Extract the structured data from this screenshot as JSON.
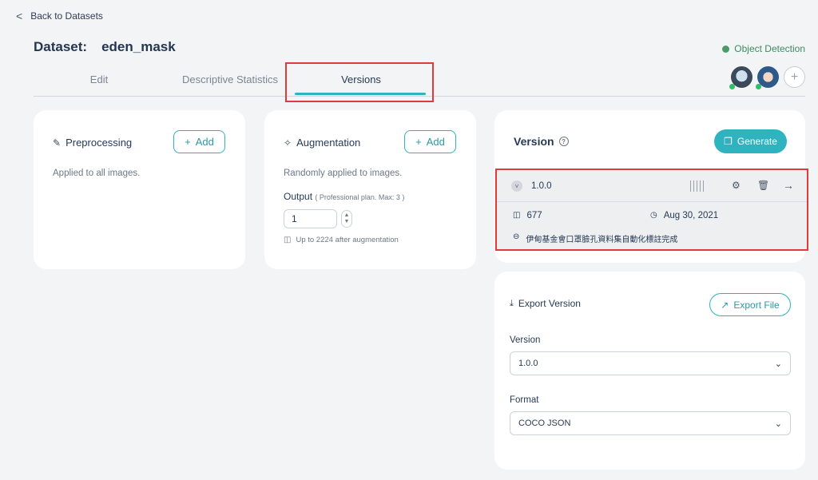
{
  "nav": {
    "back_label": "Back to Datasets"
  },
  "header": {
    "dataset_label": "Dataset:",
    "dataset_name": "eden_mask",
    "project_type": "Object Detection",
    "add_member": "+"
  },
  "tabs": [
    {
      "label": "Edit"
    },
    {
      "label": "Descriptive Statistics"
    },
    {
      "label": "Versions",
      "active": true
    }
  ],
  "preprocessing": {
    "title": "Preprocessing",
    "add_label": "Add",
    "description": "Applied to all images."
  },
  "augmentation": {
    "title": "Augmentation",
    "add_label": "Add",
    "description": "Randomly applied to images.",
    "output_label": "Output",
    "output_note": "( Professional plan. Max: 3 )",
    "output_value": "1",
    "result_note": "Up to 2224 after augmentation"
  },
  "version_panel": {
    "title": "Version",
    "generate_label": "Generate",
    "item": {
      "version": "1.0.0",
      "image_count": "677",
      "date": "Aug 30, 2021",
      "note": "伊甸基金會口罩臉孔資料集自動化標註完成"
    }
  },
  "export": {
    "title": "Export Version",
    "export_label": "Export File",
    "version_label": "Version",
    "version_value": "1.0.0",
    "format_label": "Format",
    "format_value": "COCO JSON"
  },
  "colors": {
    "accent": "#2fb3bf",
    "highlight": "#e03a3a",
    "status": "#4a9a6a"
  }
}
